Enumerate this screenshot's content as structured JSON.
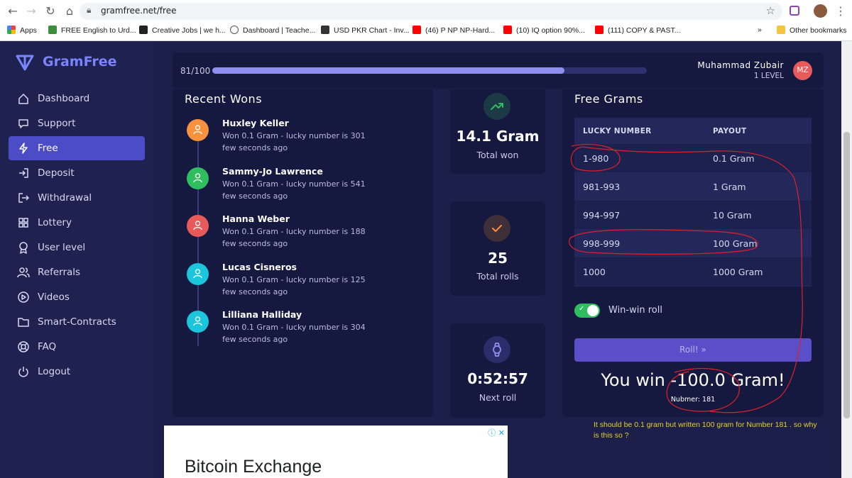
{
  "browser": {
    "url": "gramfree.net/free",
    "bookmarks": [
      {
        "label": "Apps"
      },
      {
        "label": "FREE English to Urd..."
      },
      {
        "label": "Creative Jobs | we h..."
      },
      {
        "label": "Dashboard | Teache..."
      },
      {
        "label": "USD PKR Chart - Inv..."
      },
      {
        "label": "(46) P NP NP-Hard..."
      },
      {
        "label": "(10) IQ option 90%..."
      },
      {
        "label": "(111) COPY & PAST..."
      }
    ],
    "more_label": "»",
    "other_bookmarks": "Other bookmarks"
  },
  "sidebar": {
    "brand": "GramFree",
    "items": [
      {
        "label": "Dashboard",
        "icon": "home-icon"
      },
      {
        "label": "Support",
        "icon": "chat-icon"
      },
      {
        "label": "Free",
        "icon": "bolt-icon",
        "active": true
      },
      {
        "label": "Deposit",
        "icon": "login-icon"
      },
      {
        "label": "Withdrawal",
        "icon": "logout-arrow-icon"
      },
      {
        "label": "Lottery",
        "icon": "grid-icon"
      },
      {
        "label": "User level",
        "icon": "award-icon"
      },
      {
        "label": "Referrals",
        "icon": "users-icon"
      },
      {
        "label": "Videos",
        "icon": "play-icon"
      },
      {
        "label": "Smart-Contracts",
        "icon": "folder-icon"
      },
      {
        "label": "FAQ",
        "icon": "lifebuoy-icon"
      },
      {
        "label": "Logout",
        "icon": "power-icon"
      }
    ]
  },
  "topbar": {
    "progress_label": "81/100",
    "progress_value": 0.81,
    "user_name": "Muhammad Zubair",
    "user_level": "1 LEVEL",
    "avatar_initials": "MZ"
  },
  "recent": {
    "title": "Recent Wons",
    "items": [
      {
        "name": "Huxley Keller",
        "desc": "Won 0.1 Gram - lucky number is 301",
        "time": "few seconds ago",
        "color": "#f7913d"
      },
      {
        "name": "Sammy-Jo Lawrence",
        "desc": "Won 0.1 Gram - lucky number is 541",
        "time": "few seconds ago",
        "color": "#2ebd5f"
      },
      {
        "name": "Hanna Weber",
        "desc": "Won 0.1 Gram - lucky number is 188",
        "time": "few seconds ago",
        "color": "#e85a5a"
      },
      {
        "name": "Lucas Cisneros",
        "desc": "Won 0.1 Gram - lucky number is 125",
        "time": "few seconds ago",
        "color": "#1bc5dc"
      },
      {
        "name": "Lilliana Halliday",
        "desc": "Won 0.1 Gram - lucky number is 304",
        "time": "few seconds ago",
        "color": "#1bc5dc"
      }
    ]
  },
  "stats": {
    "total_won": {
      "value": "14.1 Gram",
      "label": "Total won"
    },
    "total_rolls": {
      "value": "25",
      "label": "Total rolls"
    },
    "next_roll": {
      "value": "0:52:57",
      "label": "Next roll"
    }
  },
  "free": {
    "title": "Free Grams",
    "col_lucky": "LUCKY NUMBER",
    "col_payout": "PAYOUT",
    "rows": [
      {
        "range": "1-980",
        "payout": "0.1 Gram"
      },
      {
        "range": "981-993",
        "payout": "1 Gram"
      },
      {
        "range": "994-997",
        "payout": "10 Gram"
      },
      {
        "range": "998-999",
        "payout": "100 Gram"
      },
      {
        "range": "1000",
        "payout": "1000 Gram"
      }
    ],
    "toggle_label": "Win-win roll",
    "toggle_on": true,
    "roll_label": "Roll! »",
    "result": "You win -100.0 Gram!",
    "number": "Nubmer: 181"
  },
  "note": "It should be  0.1 gram but written 100 gram for Number 181 . so why is this so ?",
  "ad": {
    "title": "Bitcoin Exchange",
    "info": "ⓘ ✕"
  },
  "colors": {
    "sidebar_bg": "#1f2251",
    "main_bg": "#1b1f4a",
    "card_bg": "#15183f",
    "accent": "#4c4cc7",
    "annotation_red": "#e0202a",
    "note_yellow": "#e6cf2e"
  }
}
